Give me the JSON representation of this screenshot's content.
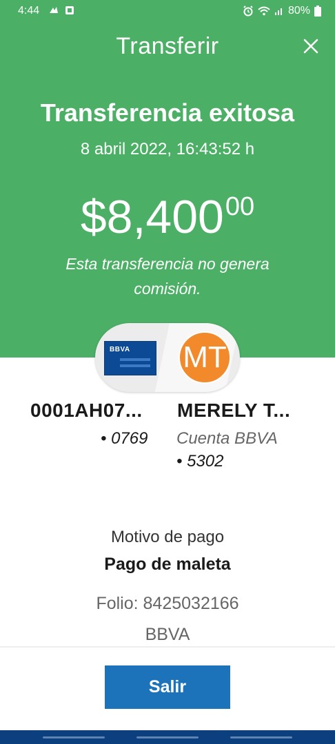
{
  "status_bar": {
    "time": "4:44",
    "battery": "80%",
    "icons": [
      "notification-icon",
      "screen-icon",
      "alarm-icon",
      "wifi-icon",
      "signal-icon",
      "battery-icon"
    ]
  },
  "header": {
    "title": "Transferir",
    "close_icon": "close-icon"
  },
  "receipt": {
    "status": "Transferencia exitosa",
    "date": "8 abril 2022, 16:43:52 h",
    "amount_main": "$8,400",
    "amount_cents": "00",
    "commission_note": "Esta transferencia no genera comisión."
  },
  "origin": {
    "card_logo": "BBVA",
    "name": "0001AH07...",
    "account": "• 0769"
  },
  "destination": {
    "initials": "MT",
    "name": "MERELY T...",
    "account_type": "Cuenta BBVA",
    "account": "• 5302"
  },
  "details": {
    "motivo_label": "Motivo de pago",
    "motivo_value": "Pago de maleta",
    "folio": "Folio: 8425032166",
    "bank": "BBVA"
  },
  "actions": {
    "exit_label": "Salir"
  },
  "colors": {
    "success_green": "#4caf66",
    "primary_blue": "#1d73b9",
    "avatar_orange": "#f28a2c",
    "card_blue": "#0d4a96"
  }
}
